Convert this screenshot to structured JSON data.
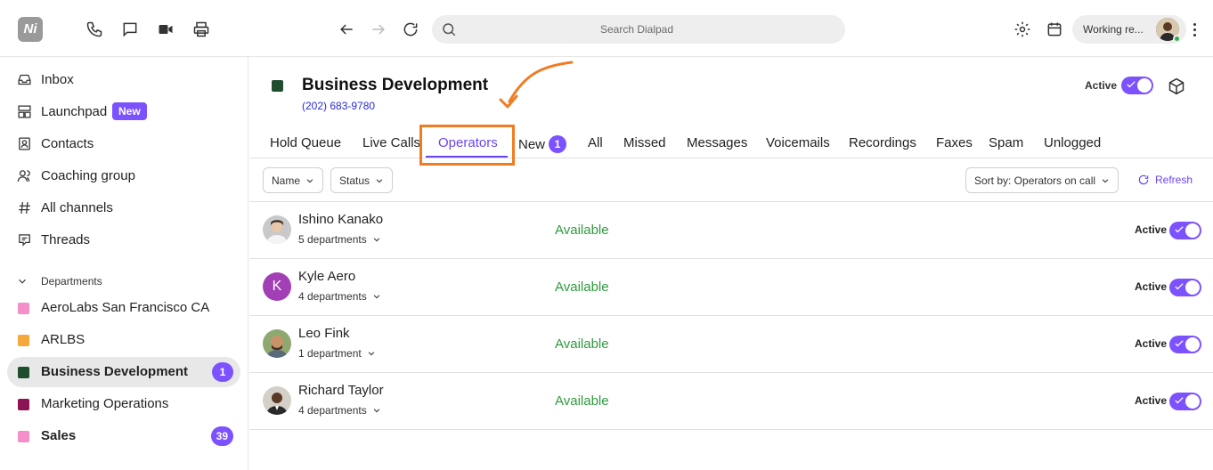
{
  "topbar": {
    "logo_text": "Ni",
    "search_placeholder": "Search Dialpad",
    "status_text": "Working re...",
    "status_color": "#2bb04a"
  },
  "sidebar": {
    "items": [
      {
        "label": "Inbox",
        "icon": "inbox-icon"
      },
      {
        "label": "Launchpad",
        "icon": "launchpad-icon",
        "badge": "New"
      },
      {
        "label": "Contacts",
        "icon": "contacts-icon"
      },
      {
        "label": "Coaching group",
        "icon": "coaching-group-icon"
      },
      {
        "label": "All channels",
        "icon": "hash-icon"
      },
      {
        "label": "Threads",
        "icon": "threads-icon"
      }
    ],
    "departments_label": "Departments",
    "departments": [
      {
        "label": "AeroLabs San Francisco CA",
        "color": "#f48fc8"
      },
      {
        "label": "ARLBS",
        "color": "#f5a93a"
      },
      {
        "label": "Business Development",
        "color": "#1f4d2e",
        "count": "1",
        "selected": true
      },
      {
        "label": "Marketing Operations",
        "color": "#8c1452"
      },
      {
        "label": "Sales",
        "color": "#f48fc8",
        "count": "39"
      }
    ]
  },
  "header": {
    "title": "Business Development",
    "phone": "(202) 683-9780",
    "active_label": "Active",
    "accent": "#7c52ff"
  },
  "tabs": [
    {
      "label": "Hold Queue"
    },
    {
      "label": "Live Calls"
    },
    {
      "label": "Operators",
      "active": true
    },
    {
      "label": "New",
      "badge": "1"
    },
    {
      "label": "All"
    },
    {
      "label": "Missed"
    },
    {
      "label": "Messages"
    },
    {
      "label": "Voicemails"
    },
    {
      "label": "Recordings"
    },
    {
      "label": "Faxes"
    },
    {
      "label": "Spam"
    },
    {
      "label": "Unlogged"
    }
  ],
  "filters": {
    "name_label": "Name",
    "status_label": "Status",
    "sort_label": "Sort by: Operators on call",
    "refresh_label": "Refresh"
  },
  "operators": [
    {
      "name": "Ishino Kanako",
      "departments": "5 departments",
      "status": "Available",
      "active_label": "Active"
    },
    {
      "name": "Kyle Aero",
      "initial": "K",
      "departments": "4 departments",
      "status": "Available",
      "active_label": "Active"
    },
    {
      "name": "Leo Fink",
      "departments": "1 department",
      "status": "Available",
      "active_label": "Active"
    },
    {
      "name": "Richard Taylor",
      "departments": "4 departments",
      "status": "Available",
      "active_label": "Active"
    }
  ]
}
